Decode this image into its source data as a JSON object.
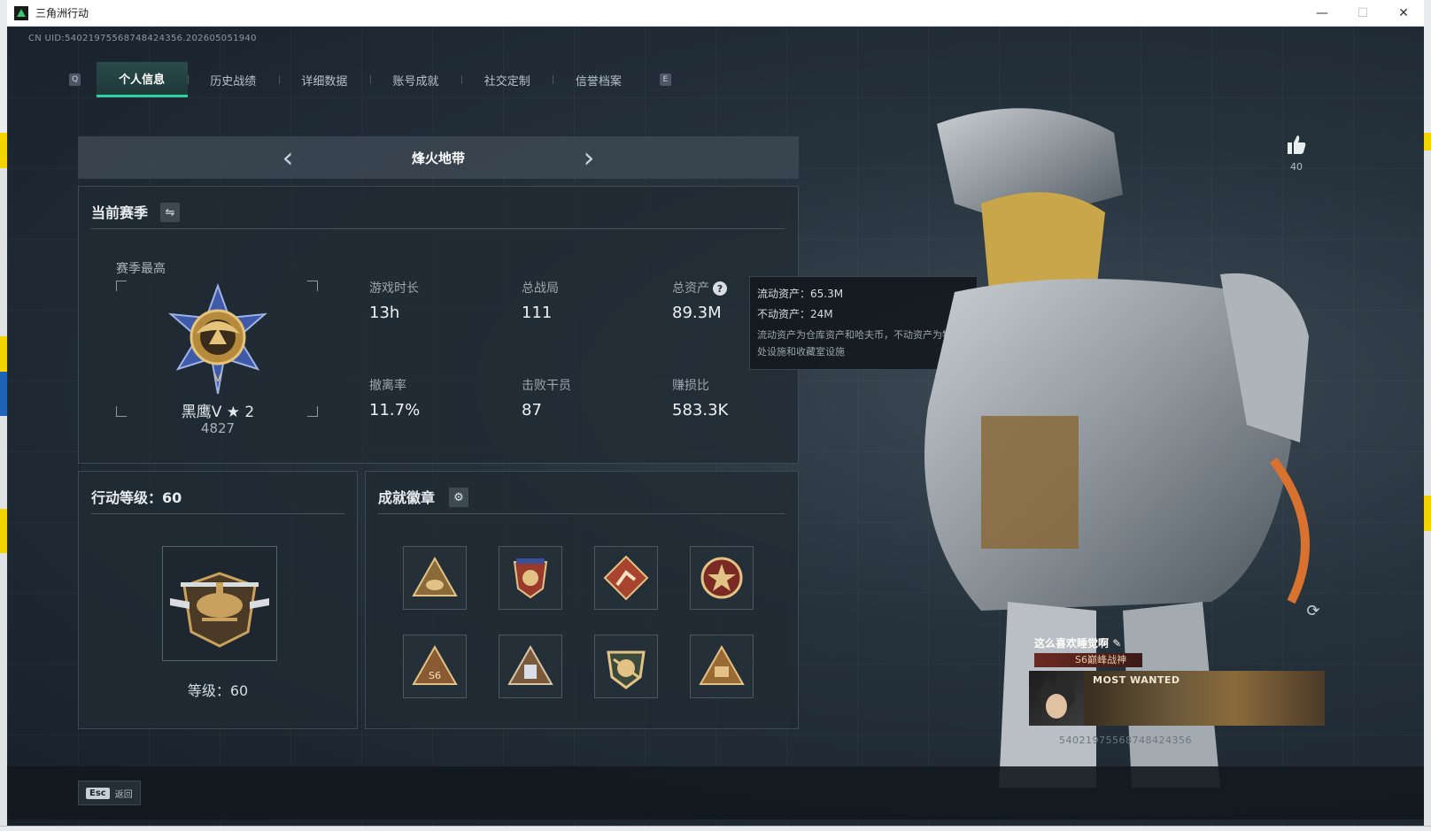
{
  "window": {
    "title": "三角洲行动",
    "controls": [
      "—",
      "☐",
      "✕"
    ]
  },
  "uid": "CN UID:5402197556874842435​6.202605051940",
  "tabs": [
    {
      "label": "个人信息",
      "active": true
    },
    {
      "label": "历史战绩"
    },
    {
      "label": "详细数据"
    },
    {
      "label": "账号成就"
    },
    {
      "label": "社交定制"
    },
    {
      "label": "信誉档案"
    }
  ],
  "tab_keys": {
    "left": "Q",
    "right": "E"
  },
  "map_selector": {
    "name": "烽火地带"
  },
  "season": {
    "title": "当前赛季",
    "best_label": "赛季最高",
    "rank_name": "黑鹰V ★ 2",
    "rank_score": "4827",
    "stats": {
      "play_time": {
        "label": "游戏时长",
        "value": "13h"
      },
      "total_matches": {
        "label": "总战局",
        "value": "111"
      },
      "total_assets": {
        "label": "总资产",
        "value": "89.3M"
      },
      "extract_rate": {
        "label": "撤离率",
        "value": "11.7%"
      },
      "kills": {
        "label": "击败干员",
        "value": "87"
      },
      "profit_ratio": {
        "label": "赚损比",
        "value": "583.3K"
      }
    }
  },
  "tooltip": {
    "liquid": "流动资产：65.3M",
    "fixed": "不动资产：24M",
    "note": "流动资产为仓库资产和哈夫币，不动资产为特勤处设施和收藏室设施"
  },
  "action_level": {
    "title": "行动等级：60",
    "level_text": "等级：60"
  },
  "achievements": {
    "title": "成就徽章"
  },
  "profile": {
    "likes": "40",
    "name": "这么喜欢睡觉啊",
    "title_badge": "S6巅峰战神",
    "banner_text": "MOST WANTED",
    "uid_watermark": "54021975568748424356"
  },
  "bottom": {
    "esc_key": "Esc",
    "esc_label": "返回"
  },
  "colors": {
    "accent": "#2ed1a0",
    "panel": "#202a33",
    "text": "#e6ecef"
  }
}
